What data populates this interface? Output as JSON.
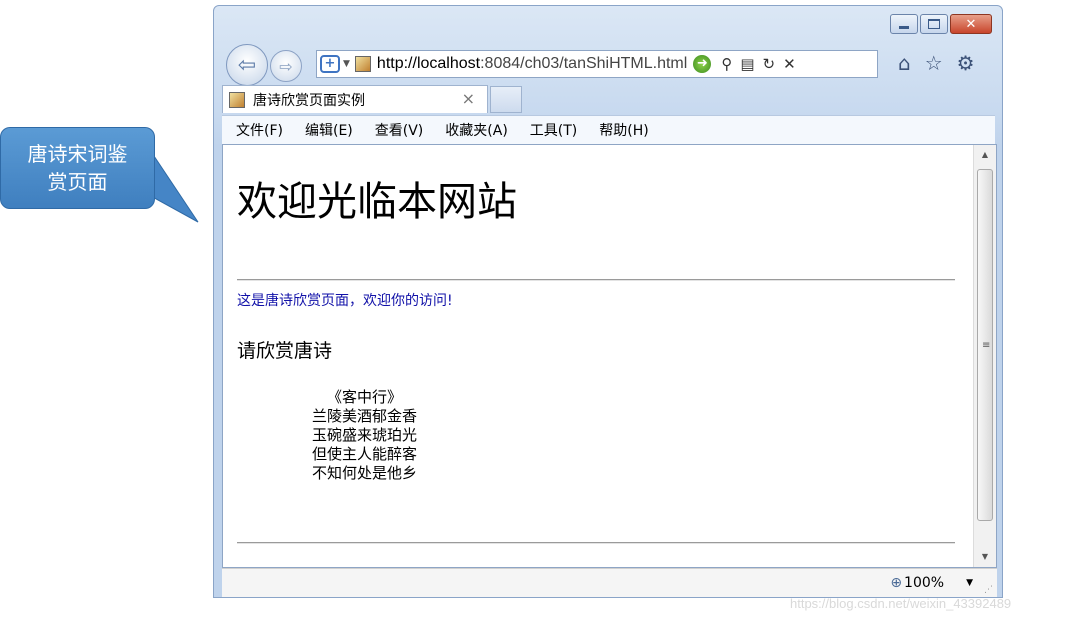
{
  "callout": {
    "line1": "唐诗宋词鉴",
    "line2": "赏页面"
  },
  "window": {
    "controls": [
      "minimize-icon",
      "maximize-icon",
      "close-icon"
    ]
  },
  "address_bar": {
    "url_host": "http://localhost",
    "url_rest": ":8084/ch03/tanShiHTML.html"
  },
  "tab": {
    "title": "唐诗欣赏页面实例",
    "close": "×"
  },
  "menu": [
    "文件(F)",
    "编辑(E)",
    "查看(V)",
    "收藏夹(A)",
    "工具(T)",
    "帮助(H)"
  ],
  "page": {
    "heading": "欢迎光临本网站",
    "welcome": "这是唐诗欣赏页面，欢迎你的访问!",
    "subheading": "请欣赏唐诗",
    "poem": [
      "《客中行》",
      "兰陵美酒郁金香",
      "玉碗盛来琥珀光",
      "但使主人能醉客",
      "不知何处是他乡"
    ]
  },
  "status": {
    "zoom": "100%"
  },
  "watermark": "https://blog.csdn.net/weixin_43392489",
  "colors": {
    "link_text": "#1010a8",
    "callout_bg": "#4a8bcb"
  }
}
